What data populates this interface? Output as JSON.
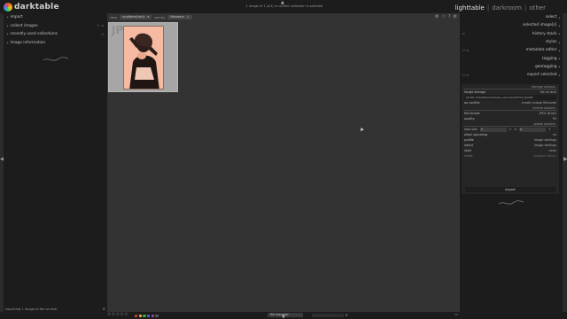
{
  "app": {
    "logo_text": "darktable",
    "views": {
      "lighttable": "lighttable",
      "separator": "|",
      "darkroom": "darkroom",
      "other": "other"
    }
  },
  "left_panel": {
    "modules": [
      {
        "label": "import"
      },
      {
        "label": "collect images"
      },
      {
        "label": "recently used collections"
      },
      {
        "label": "image information"
      }
    ],
    "status": "exporting 1 image to file on disk",
    "close_glyph": "×"
  },
  "center": {
    "collection_info": "1 image of 1 (#1) in current collection is selected",
    "view_label": "view",
    "view_value": "unaltered only",
    "sort_label": "sort by",
    "sort_value": "filename",
    "thumbnail": {
      "extension": "JPG"
    }
  },
  "right_panel": {
    "modules": [
      {
        "label": "select"
      },
      {
        "label": "selected image[s]"
      },
      {
        "label": "history stack"
      },
      {
        "label": "styles"
      },
      {
        "label": "metadata editor"
      },
      {
        "label": "tagging"
      },
      {
        "label": "geotagging"
      },
      {
        "label": "export selected"
      }
    ],
    "export": {
      "storage_options": "storage options",
      "target_storage_label": "target storage",
      "target_storage_value": "file on disk",
      "path": "$(FILE_FOLDER)/darktable_exported/$(FILE_NAME)",
      "on_conflict_label": "on conflict",
      "on_conflict_value": "create unique filename",
      "format_options": "format options",
      "file_format_label": "file format",
      "file_format_value": "JPEG (8-bit)",
      "quality_label": "quality",
      "quality_value": "95",
      "global_options": "global options",
      "max_size_label": "max size",
      "max_w": "0",
      "max_h": "0",
      "allow_upscaling_label": "allow upscaling",
      "allow_upscaling_value": "no",
      "profile_label": "profile",
      "profile_value": "image settings",
      "intent_label": "intent",
      "intent_value": "image settings",
      "style_label": "style",
      "style_value": "none",
      "mode_label": "mode",
      "mode_value": "append history",
      "export_button": "export"
    }
  },
  "bottom": {
    "stars": "☆☆☆☆☆",
    "layout_mode": "file manager",
    "zoom_value": "5",
    "label_colors": [
      "#e04040",
      "#e0c040",
      "#40b040",
      "#4070e0",
      "#b040c0",
      "#555555"
    ]
  },
  "icons": {
    "top_arrow": "▲",
    "bottom_arrow": "▼",
    "left_arrow": "◀",
    "right_arrow": "▶"
  }
}
